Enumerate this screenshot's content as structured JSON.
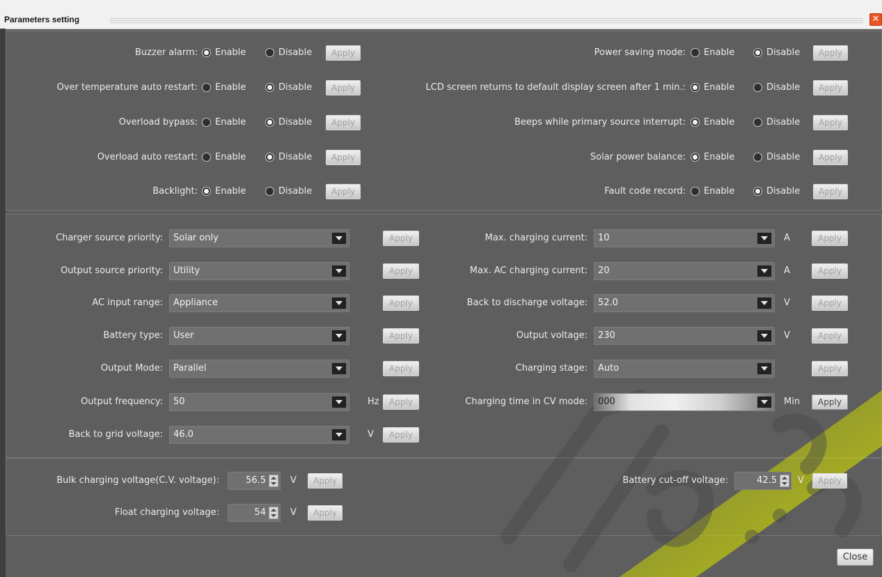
{
  "window": {
    "title": "Parameters setting",
    "close_glyph": "✕"
  },
  "apply_label": "Apply",
  "toggles": [
    {
      "label": "Buzzer alarm:",
      "enable": "Enable",
      "disable": "Disable",
      "selected": "Enable"
    },
    {
      "label": "Over temperature auto restart:",
      "enable": "Enable",
      "disable": "Disable",
      "selected": "Disable"
    },
    {
      "label": "Overload bypass:",
      "enable": "Enable",
      "disable": "Disable",
      "selected": "Disable"
    },
    {
      "label": "Overload auto restart:",
      "enable": "Enable",
      "disable": "Disable",
      "selected": "Disable"
    },
    {
      "label": "Backlight:",
      "enable": "Enable",
      "disable": "Disable",
      "selected": "Enable"
    },
    {
      "label": "Power saving mode:",
      "enable": "Enable",
      "disable": "Disable",
      "selected": "Disable"
    },
    {
      "label": "LCD screen returns to default display screen after 1 min.:",
      "enable": "Enable",
      "disable": "Disable",
      "selected": "Enable"
    },
    {
      "label": "Beeps while primary source interrupt:",
      "enable": "Enable",
      "disable": "Disable",
      "selected": "Enable"
    },
    {
      "label": "Solar power balance:",
      "enable": "Enable",
      "disable": "Disable",
      "selected": "Enable"
    },
    {
      "label": "Fault code record:",
      "enable": "Enable",
      "disable": "Disable",
      "selected": "Disable"
    }
  ],
  "combos": [
    {
      "label": "Charger source priority:",
      "value": "Solar only",
      "unit": ""
    },
    {
      "label": "Output source priority:",
      "value": "Utility",
      "unit": ""
    },
    {
      "label": "AC input range:",
      "value": "Appliance",
      "unit": ""
    },
    {
      "label": "Battery type:",
      "value": "User",
      "unit": ""
    },
    {
      "label": "Output Mode:",
      "value": "Parallel",
      "unit": ""
    },
    {
      "label": "Output frequency:",
      "value": "50",
      "unit": "Hz"
    },
    {
      "label": "Back to grid voltage:",
      "value": "46.0",
      "unit": "V"
    },
    {
      "label": "Max. charging current:",
      "value": "10",
      "unit": "A"
    },
    {
      "label": "Max. AC charging current:",
      "value": "20",
      "unit": "A"
    },
    {
      "label": "Back to discharge voltage:",
      "value": "52.0",
      "unit": "V"
    },
    {
      "label": "Output voltage:",
      "value": "230",
      "unit": "V"
    },
    {
      "label": "Charging stage:",
      "value": "Auto",
      "unit": ""
    },
    {
      "label": "Charging time in CV mode:",
      "value": "000",
      "unit": "Min"
    }
  ],
  "spinners": [
    {
      "label": "Bulk charging voltage(C.V. voltage):",
      "value": "56.5",
      "unit": "V"
    },
    {
      "label": "Float charging voltage:",
      "value": "54",
      "unit": "V"
    },
    {
      "label": "Battery cut-off voltage:",
      "value": "42.5",
      "unit": "V"
    }
  ],
  "close_label": "Close",
  "watermark": {
    "text": "LED.com",
    "color": "#c8d400"
  }
}
